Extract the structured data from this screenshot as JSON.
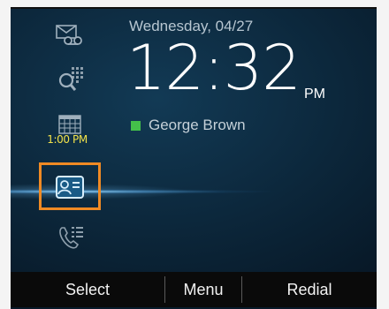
{
  "status": {
    "date": "Wednesday, 04/27",
    "time": "12:32",
    "ampm": "PM",
    "user_name": "George Brown",
    "presence_color": "#44c04a"
  },
  "sidebar": {
    "items": [
      {
        "icon": "voicemail-icon",
        "label": ""
      },
      {
        "icon": "directory-search-icon",
        "label": ""
      },
      {
        "icon": "calendar-icon",
        "label": "1:00 PM"
      },
      {
        "icon": "contact-card-icon",
        "label": "",
        "selected": true
      },
      {
        "icon": "call-log-icon",
        "label": ""
      }
    ],
    "selection_color": "#f08a24",
    "label_color": "#f2e24a"
  },
  "softkeys": [
    {
      "label": "Select"
    },
    {
      "label": "Menu"
    },
    {
      "label": "Redial"
    }
  ]
}
